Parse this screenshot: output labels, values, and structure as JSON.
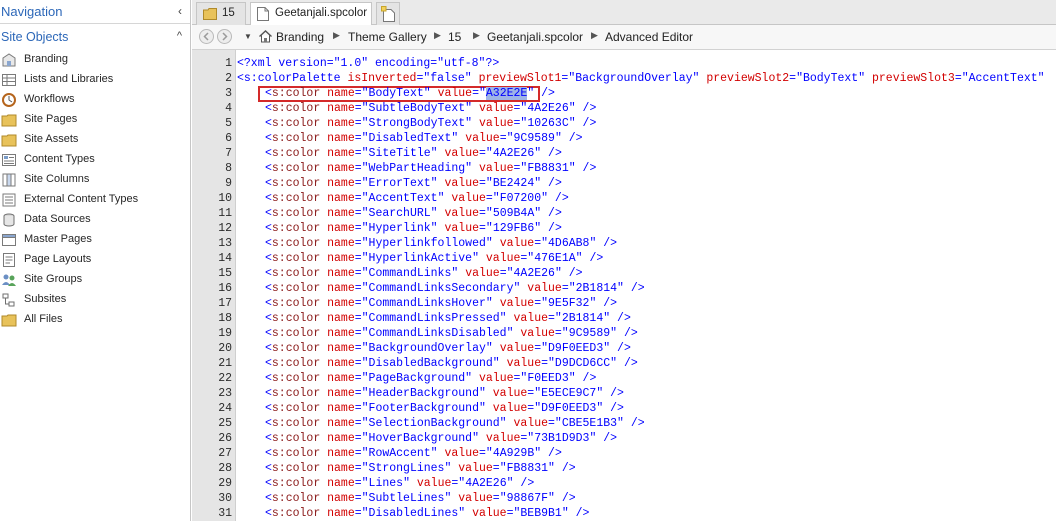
{
  "nav": {
    "title": "Navigation",
    "collapse_glyph": "‹",
    "site_objects": "Site Objects",
    "site_objects_glyph": "^",
    "items": [
      {
        "label": "Branding",
        "icon": "branding-icon"
      },
      {
        "label": "Lists and Libraries",
        "icon": "lists-icon"
      },
      {
        "label": "Workflows",
        "icon": "workflows-icon"
      },
      {
        "label": "Site Pages",
        "icon": "site-pages-icon"
      },
      {
        "label": "Site Assets",
        "icon": "site-assets-icon"
      },
      {
        "label": "Content Types",
        "icon": "content-types-icon"
      },
      {
        "label": "Site Columns",
        "icon": "site-columns-icon"
      },
      {
        "label": "External Content Types",
        "icon": "external-content-types-icon"
      },
      {
        "label": "Data Sources",
        "icon": "data-sources-icon"
      },
      {
        "label": "Master Pages",
        "icon": "master-pages-icon"
      },
      {
        "label": "Page Layouts",
        "icon": "page-layouts-icon"
      },
      {
        "label": "Site Groups",
        "icon": "site-groups-icon"
      },
      {
        "label": "Subsites",
        "icon": "subsites-icon"
      },
      {
        "label": "All Files",
        "icon": "all-files-icon"
      }
    ]
  },
  "tabs": {
    "folder_tab": "15",
    "file_tab": "Geetanjali.spcolor"
  },
  "breadcrumb": {
    "items": [
      "Branding",
      "Theme Gallery",
      "15",
      "Geetanjali.spcolor",
      "Advanced Editor"
    ]
  },
  "code": {
    "line_numbers": [
      "1",
      "2",
      "3",
      "4",
      "5",
      "6",
      "7",
      "8",
      "9",
      "10",
      "11",
      "12",
      "13",
      "14",
      "15",
      "16",
      "17",
      "18",
      "19",
      "20",
      "21",
      "22",
      "23",
      "24",
      "25",
      "26",
      "27",
      "28",
      "29",
      "30",
      "31"
    ],
    "xml_decl": "<?xml version=\"1.0\" encoding=\"utf-8\"?>",
    "palette_open": {
      "tag": "<s:colorPalette",
      "a1": "isInverted",
      "v1": "\"false\"",
      "a2": "previewSlot1",
      "v2": "\"BackgroundOverlay\"",
      "a3": "previewSlot2",
      "v3": "\"BodyText\"",
      "a4": "previewSlot3",
      "v4": "\"AccentText\""
    },
    "colors": [
      {
        "name": "BodyText",
        "value": "A32E2E"
      },
      {
        "name": "SubtleBodyText",
        "value": "4A2E26"
      },
      {
        "name": "StrongBodyText",
        "value": "10263C"
      },
      {
        "name": "DisabledText",
        "value": "9C9589"
      },
      {
        "name": "SiteTitle",
        "value": "4A2E26"
      },
      {
        "name": "WebPartHeading",
        "value": "FB8831"
      },
      {
        "name": "ErrorText",
        "value": "BE2424"
      },
      {
        "name": "AccentText",
        "value": "F07200"
      },
      {
        "name": "SearchURL",
        "value": "509B4A"
      },
      {
        "name": "Hyperlink",
        "value": "129FB6"
      },
      {
        "name": "Hyperlinkfollowed",
        "value": "4D6AB8"
      },
      {
        "name": "HyperlinkActive",
        "value": "476E1A"
      },
      {
        "name": "CommandLinks",
        "value": "4A2E26"
      },
      {
        "name": "CommandLinksSecondary",
        "value": "2B1814"
      },
      {
        "name": "CommandLinksHover",
        "value": "9E5F32"
      },
      {
        "name": "CommandLinksPressed",
        "value": "2B1814"
      },
      {
        "name": "CommandLinksDisabled",
        "value": "9C9589"
      },
      {
        "name": "BackgroundOverlay",
        "value": "D9F0EED3"
      },
      {
        "name": "DisabledBackground",
        "value": "D9DCD6CC"
      },
      {
        "name": "PageBackground",
        "value": "F0EED3"
      },
      {
        "name": "HeaderBackground",
        "value": "E5ECE9C7"
      },
      {
        "name": "FooterBackground",
        "value": "D9F0EED3"
      },
      {
        "name": "SelectionBackground",
        "value": "CBE5E1B3"
      },
      {
        "name": "HoverBackground",
        "value": "73B1D9D3"
      },
      {
        "name": "RowAccent",
        "value": "4A929B"
      },
      {
        "name": "StrongLines",
        "value": "FB8831"
      },
      {
        "name": "Lines",
        "value": "4A2E26"
      },
      {
        "name": "SubtleLines",
        "value": "98867F"
      },
      {
        "name": "DisabledLines",
        "value": "BEB9B1"
      }
    ],
    "selected_value": "A32E2E"
  },
  "theme": {
    "accent": "#2c67b8",
    "tag_color": "#0000ff",
    "element_color": "#8b1a1a",
    "attr_color": "#d20000",
    "highlight_box": "#d42a2a"
  }
}
